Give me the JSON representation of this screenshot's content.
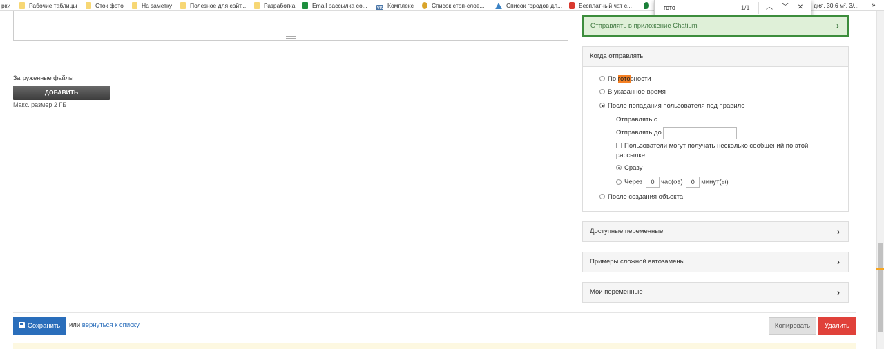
{
  "bookmarks": {
    "items": [
      {
        "label": "рки",
        "icon": "none"
      },
      {
        "label": "Рабочие таблицы",
        "icon": "folder-icon"
      },
      {
        "label": "Сток фото",
        "icon": "folder-icon"
      },
      {
        "label": "На заметку",
        "icon": "folder-icon"
      },
      {
        "label": "Полезное для сайт...",
        "icon": "folder-icon"
      },
      {
        "label": "Разработка",
        "icon": "folder-icon"
      },
      {
        "label": "Email рассылка со...",
        "icon": "sheets-icon"
      },
      {
        "label": "Комплекс",
        "icon": "vk-icon"
      },
      {
        "label": "Список стоп-слов...",
        "icon": "database-icon"
      },
      {
        "label": "Список городов дл...",
        "icon": "triangle-icon"
      },
      {
        "label": "Бесплатный чат с...",
        "icon": "chat-icon"
      },
      {
        "label": "",
        "icon": "green-drop-icon"
      },
      {
        "label": "дия, 30,6 м², 3/...",
        "icon": "none"
      }
    ],
    "overflow": "»",
    "vk_glyph": "VK"
  },
  "findbar": {
    "query": "гото",
    "count": "1/1",
    "prev": "︿",
    "next": "﹀",
    "close": "✕"
  },
  "uploads": {
    "label": "Загруженные файлы",
    "add_button": "ДОБАВИТЬ",
    "max_size": "Макс. размер 2 ГБ"
  },
  "panels": {
    "chatium": {
      "label": "Отправлять в приложение Chatium",
      "chevron": "›"
    },
    "when": {
      "title": "Когда отправлять",
      "option_ready_prefix": "По ",
      "option_ready_highlight": "гото",
      "option_ready_suffix": "вности",
      "option_time": "В указанное время",
      "option_rule": "После попадания пользователя под правило",
      "send_from_label": "Отправлять с",
      "send_to_label": "Отправлять до",
      "multiple_messages": "Пользователи могут получать несколько сообщений по этой рассылке",
      "immediately": "Сразу",
      "after_prefix": "Через",
      "hours_value": "0",
      "hours_label": "час(ов)",
      "minutes_value": "0",
      "minutes_label": "минут(ы)",
      "option_object": "После создания объекта"
    },
    "variables": {
      "label": "Доступные переменные",
      "chevron": "›"
    },
    "examples": {
      "label": "Примеры сложной автозамены",
      "chevron": "›"
    },
    "my_variables": {
      "label": "Мои переменные",
      "chevron": "›"
    }
  },
  "footer": {
    "save": "Сохранить",
    "or": "или ",
    "back_link": "вернуться к списку",
    "copy": "Копировать",
    "delete": "Удалить"
  }
}
